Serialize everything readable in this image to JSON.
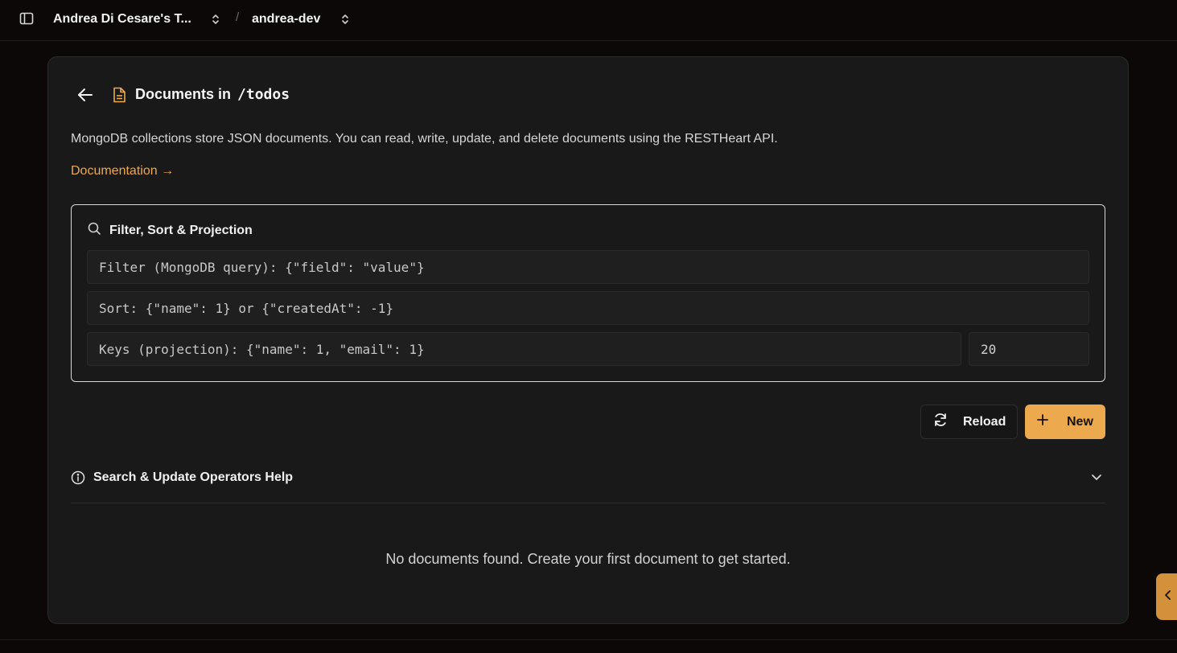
{
  "topbar": {
    "team_name": "Andrea Di Cesare's T...",
    "separator": "/",
    "project_name": "andrea-dev"
  },
  "header": {
    "title_prefix": "Documents in",
    "collection_path": "/todos"
  },
  "description": "MongoDB collections store JSON documents. You can read, write, update, and delete documents using the RESTHeart API.",
  "documentation_link": "Documentation →",
  "filter_panel": {
    "title": "Filter, Sort & Projection",
    "filter_placeholder": "Filter (MongoDB query): {\"field\": \"value\"}",
    "sort_placeholder": "Sort: {\"name\": 1} or {\"createdAt\": -1}",
    "keys_placeholder": "Keys (projection): {\"name\": 1, \"email\": 1}",
    "page_size": "20"
  },
  "actions": {
    "reload_label": "Reload",
    "new_label": "New"
  },
  "help": {
    "title": "Search & Update Operators Help"
  },
  "empty_state": "No documents found. Create your first document to get started.",
  "colors": {
    "accent": "#eda94e",
    "background": "#0c0807",
    "panel": "#191919"
  }
}
